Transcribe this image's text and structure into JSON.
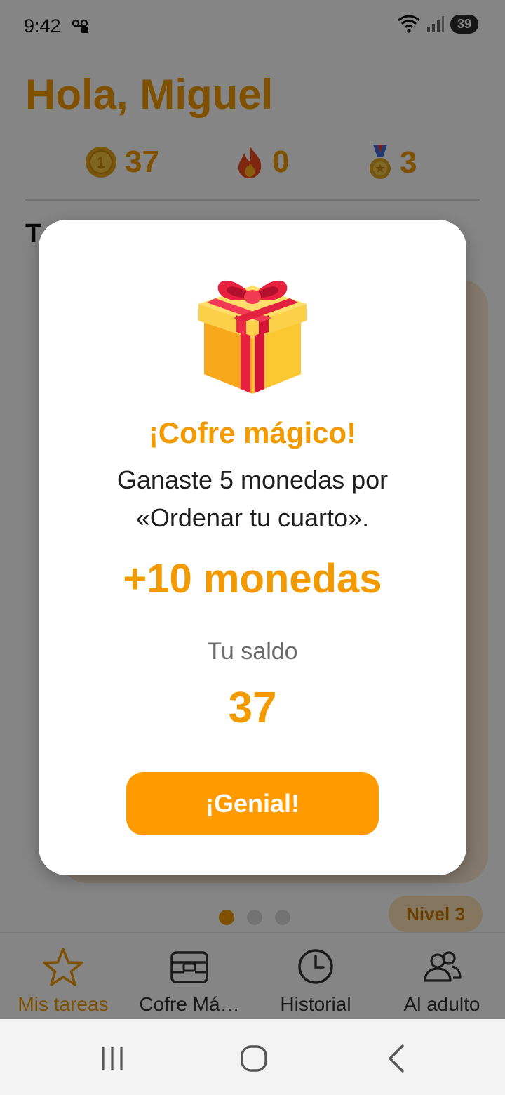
{
  "status_bar": {
    "time": "9:42",
    "battery": "39",
    "icons": [
      "voicemail-icon",
      "wifi-icon",
      "signal-icon"
    ]
  },
  "header": {
    "greeting": "Hola, Miguel",
    "stats": {
      "coins": "37",
      "streak": "0",
      "medals": "3"
    },
    "section_title_partial": "T"
  },
  "background": {
    "level_badge": "Nivel 3",
    "pager_dots": 3,
    "pager_active": 0
  },
  "bottom_nav": {
    "items": [
      {
        "label": "Mis tareas",
        "icon": "star-icon",
        "active": true
      },
      {
        "label": "Cofre Má…",
        "icon": "chest-icon",
        "active": false
      },
      {
        "label": "Historial",
        "icon": "clock-icon",
        "active": false
      },
      {
        "label": "Al adulto",
        "icon": "users-icon",
        "active": false
      }
    ]
  },
  "dialog": {
    "icon": "gift-icon",
    "title": "¡Cofre mágico!",
    "message": "Ganaste 5 monedas por «Ordenar tu cuarto».",
    "reward": "+10 monedas",
    "balance_label": "Tu saldo",
    "balance": "37",
    "button_label": "¡Genial!"
  },
  "colors": {
    "accent": "#f29a00",
    "button": "#ff9a00",
    "scrim": "#000000"
  }
}
